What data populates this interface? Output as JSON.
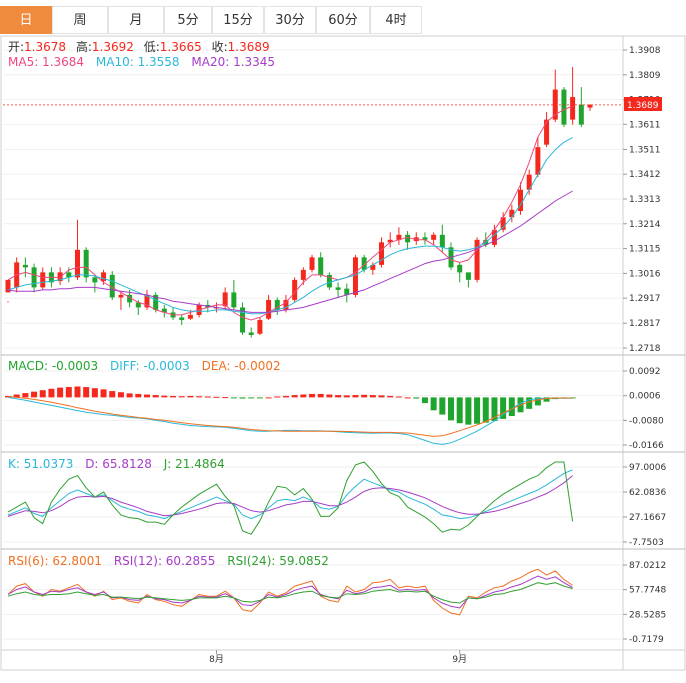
{
  "tabs": [
    {
      "label": "日",
      "active": true
    },
    {
      "label": "周",
      "active": false
    },
    {
      "label": "月",
      "active": false
    },
    {
      "label": "5分",
      "active": false
    },
    {
      "label": "15分",
      "active": false
    },
    {
      "label": "30分",
      "active": false
    },
    {
      "label": "60分",
      "active": false
    },
    {
      "label": "4时",
      "active": false
    }
  ],
  "price_info": {
    "open_label": "开:",
    "open": "1.3678",
    "high_label": "高:",
    "high": "1.3692",
    "low_label": "低:",
    "low": "1.3665",
    "close_label": "收:",
    "close": "1.3689",
    "ma5": "MA5: 1.3684",
    "ma10": "MA10: 1.3558",
    "ma20": "MA20: 1.3345"
  },
  "macd_info": {
    "macd": "MACD: -0.0003",
    "diff": "DIFF: -0.0003",
    "dea": "DEA: -0.0002"
  },
  "kdj_info": {
    "k": "K: 51.0373",
    "d": "D: 65.8128",
    "j": "J: 21.4864"
  },
  "rsi_info": {
    "rsi6": "RSI(6): 62.8001",
    "rsi12": "RSI(12): 60.2855",
    "rsi24": "RSI(24): 59.0852"
  },
  "current_price_label": "1.3689",
  "x_labels": [
    {
      "label": "8月",
      "index": 24
    },
    {
      "label": "9月",
      "index": 52
    }
  ],
  "colors": {
    "up": "#f4281c",
    "down": "#1fa52d",
    "ma5": "#f0487c",
    "ma10": "#2ab8d8",
    "ma20": "#a63cc8",
    "tab_active": "#f08a3c",
    "diff": "#2ab8d8",
    "dea": "#f07020",
    "k": "#2ab8d8",
    "d": "#a63cc8",
    "j": "#30a030",
    "rsi6": "#f07020",
    "rsi12": "#a63cc8",
    "rsi24": "#30a030"
  },
  "chart_data": [
    {
      "type": "candlestick",
      "name": "price",
      "y_ticks": [
        "1.3908",
        "1.3809",
        "1.3710",
        "1.3611",
        "1.3511",
        "1.3412",
        "1.3313",
        "1.3214",
        "1.3115",
        "1.3016",
        "1.2917",
        "1.2817",
        "1.2718"
      ],
      "ylim": [
        1.27,
        1.3935
      ],
      "candles": [
        [
          1.294,
          1.299,
          1.2905,
          1.29
        ],
        [
          1.296,
          1.306,
          1.308,
          1.294
        ],
        [
          1.305,
          1.304,
          1.308,
          1.3
        ],
        [
          1.304,
          1.296,
          1.3055,
          1.294
        ],
        [
          1.296,
          1.302,
          1.304,
          1.295
        ],
        [
          1.302,
          1.298,
          1.304,
          1.296
        ],
        [
          1.2985,
          1.302,
          1.304,
          1.297
        ],
        [
          1.302,
          1.3,
          1.304,
          1.298
        ],
        [
          1.3,
          1.311,
          1.323,
          1.299
        ],
        [
          1.311,
          1.3,
          1.312,
          1.298
        ],
        [
          1.3,
          1.298,
          1.301,
          1.294
        ],
        [
          1.2985,
          1.302,
          1.303,
          1.297
        ],
        [
          1.301,
          1.292,
          1.3025,
          1.291
        ],
        [
          1.292,
          1.293,
          1.2945,
          1.287
        ],
        [
          1.293,
          1.29,
          1.295,
          1.288
        ],
        [
          1.29,
          1.288,
          1.291,
          1.285
        ],
        [
          1.288,
          1.293,
          1.295,
          1.287
        ],
        [
          1.293,
          1.287,
          1.294,
          1.286
        ],
        [
          1.2875,
          1.286,
          1.289,
          1.284
        ],
        [
          1.286,
          1.284,
          1.288,
          1.283
        ],
        [
          1.284,
          1.283,
          1.285,
          1.281
        ],
        [
          1.2835,
          1.285,
          1.287,
          1.283
        ],
        [
          1.285,
          1.289,
          1.29,
          1.284
        ],
        [
          1.289,
          1.288,
          1.291,
          1.286
        ],
        [
          1.288,
          1.288,
          1.29,
          1.286
        ],
        [
          1.2885,
          1.294,
          1.296,
          1.287
        ],
        [
          1.294,
          1.288,
          1.299,
          1.287
        ],
        [
          1.288,
          1.278,
          1.29,
          1.277
        ],
        [
          1.278,
          1.277,
          1.28,
          1.276
        ],
        [
          1.2775,
          1.283,
          1.284,
          1.277
        ],
        [
          1.2835,
          1.291,
          1.293,
          1.283
        ],
        [
          1.291,
          1.287,
          1.292,
          1.285
        ],
        [
          1.287,
          1.291,
          1.293,
          1.286
        ],
        [
          1.291,
          1.299,
          1.3,
          1.29
        ],
        [
          1.299,
          1.303,
          1.304,
          1.297
        ],
        [
          1.303,
          1.308,
          1.309,
          1.302
        ],
        [
          1.308,
          1.301,
          1.31,
          1.3
        ],
        [
          1.301,
          1.296,
          1.302,
          1.295
        ],
        [
          1.296,
          1.295,
          1.298,
          1.292
        ],
        [
          1.2955,
          1.293,
          1.2975,
          1.29
        ],
        [
          1.293,
          1.308,
          1.309,
          1.292
        ],
        [
          1.308,
          1.303,
          1.309,
          1.302
        ],
        [
          1.303,
          1.305,
          1.306,
          1.301
        ],
        [
          1.305,
          1.314,
          1.316,
          1.304
        ],
        [
          1.314,
          1.315,
          1.318,
          1.312
        ],
        [
          1.315,
          1.317,
          1.32,
          1.313
        ],
        [
          1.317,
          1.314,
          1.3185,
          1.311
        ],
        [
          1.3145,
          1.316,
          1.318,
          1.313
        ],
        [
          1.316,
          1.315,
          1.318,
          1.313
        ],
        [
          1.315,
          1.317,
          1.318,
          1.313
        ],
        [
          1.317,
          1.312,
          1.321,
          1.31
        ],
        [
          1.312,
          1.304,
          1.314,
          1.303
        ],
        [
          1.305,
          1.302,
          1.306,
          1.298
        ],
        [
          1.302,
          1.299,
          1.3,
          1.296
        ],
        [
          1.299,
          1.315,
          1.316,
          1.298
        ],
        [
          1.315,
          1.313,
          1.318,
          1.312
        ],
        [
          1.313,
          1.319,
          1.321,
          1.312
        ],
        [
          1.319,
          1.324,
          1.326,
          1.318
        ],
        [
          1.324,
          1.327,
          1.329,
          1.322
        ],
        [
          1.3265,
          1.335,
          1.338,
          1.325
        ],
        [
          1.335,
          1.341,
          1.343,
          1.333
        ],
        [
          1.341,
          1.352,
          1.356,
          1.34
        ],
        [
          1.353,
          1.363,
          1.366,
          1.352
        ],
        [
          1.363,
          1.375,
          1.383,
          1.362
        ],
        [
          1.375,
          1.361,
          1.376,
          1.36
        ],
        [
          1.363,
          1.372,
          1.384,
          1.361
        ],
        [
          1.369,
          1.361,
          1.376,
          1.36
        ],
        [
          1.3678,
          1.3689,
          1.3692,
          1.3665
        ]
      ],
      "ma5": [
        1.299,
        1.301,
        1.302,
        1.301,
        1.3,
        1.3,
        1.3,
        1.303,
        1.304,
        1.304,
        1.301,
        1.298,
        1.296,
        1.294,
        1.292,
        1.29,
        1.289,
        1.287,
        1.286,
        1.285,
        1.285,
        1.286,
        1.287,
        1.288,
        1.289,
        1.289,
        1.286,
        1.284,
        1.283,
        1.284,
        1.286,
        1.288,
        1.29,
        1.294,
        1.298,
        1.301,
        1.301,
        1.3,
        1.299,
        1.3,
        1.302,
        1.305,
        1.308,
        1.311,
        1.314,
        1.315,
        1.316,
        1.315,
        1.315,
        1.313,
        1.31,
        1.307,
        1.306,
        1.307,
        1.311,
        1.315,
        1.319,
        1.324,
        1.33,
        1.337,
        1.346,
        1.356,
        1.362,
        1.365,
        1.367,
        1.3684
      ],
      "ma10": [
        1.295,
        1.296,
        1.297,
        1.2975,
        1.298,
        1.2985,
        1.299,
        1.3,
        1.301,
        1.301,
        1.3005,
        1.2995,
        1.2985,
        1.297,
        1.2955,
        1.294,
        1.2925,
        1.291,
        1.2895,
        1.288,
        1.287,
        1.2865,
        1.2865,
        1.2865,
        1.287,
        1.287,
        1.2865,
        1.286,
        1.2855,
        1.2855,
        1.286,
        1.287,
        1.288,
        1.29,
        1.292,
        1.2945,
        1.2965,
        1.298,
        1.299,
        1.3,
        1.301,
        1.303,
        1.305,
        1.307,
        1.309,
        1.3105,
        1.3115,
        1.312,
        1.3125,
        1.3125,
        1.312,
        1.311,
        1.3105,
        1.311,
        1.312,
        1.314,
        1.317,
        1.32,
        1.324,
        1.329,
        1.335,
        1.341,
        1.347,
        1.351,
        1.354,
        1.3558
      ],
      "ma20": [
        1.295,
        1.2945,
        1.2945,
        1.2945,
        1.295,
        1.295,
        1.2955,
        1.2955,
        1.296,
        1.296,
        1.296,
        1.2955,
        1.295,
        1.2945,
        1.294,
        1.2935,
        1.293,
        1.292,
        1.2915,
        1.2905,
        1.29,
        1.2895,
        1.289,
        1.2885,
        1.288,
        1.2875,
        1.287,
        1.2865,
        1.286,
        1.286,
        1.286,
        1.2865,
        1.287,
        1.2875,
        1.288,
        1.289,
        1.29,
        1.291,
        1.292,
        1.293,
        1.294,
        1.295,
        1.2965,
        1.298,
        1.2995,
        1.301,
        1.3025,
        1.304,
        1.3055,
        1.3065,
        1.307,
        1.308,
        1.309,
        1.31,
        1.3115,
        1.313,
        1.3145,
        1.3165,
        1.3185,
        1.3205,
        1.323,
        1.3255,
        1.328,
        1.3305,
        1.3325,
        1.3345
      ]
    },
    {
      "type": "bar",
      "name": "MACD",
      "y_ticks": [
        "0.0092",
        "0.0006",
        "-0.0080",
        "-0.0166"
      ],
      "ylim": [
        -0.0185,
        0.0105
      ],
      "macd": [
        0.0005,
        0.001,
        0.0015,
        0.002,
        0.0025,
        0.003,
        0.0034,
        0.0036,
        0.0038,
        0.0036,
        0.0032,
        0.0028,
        0.0022,
        0.0018,
        0.0014,
        0.0012,
        0.001,
        0.0008,
        0.0006,
        0.0005,
        0.0004,
        0.0005,
        0.0004,
        0.0003,
        0.0002,
        0.0001,
        -0.0002,
        -0.0004,
        -0.0003,
        -0.0002,
        0.0,
        0.0003,
        0.0005,
        0.0008,
        0.001,
        0.0012,
        0.0012,
        0.001,
        0.0008,
        0.0007,
        0.0008,
        0.0009,
        0.0008,
        0.0007,
        0.0005,
        0.0003,
        0.0,
        -0.0004,
        -0.002,
        -0.0045,
        -0.006,
        -0.008,
        -0.009,
        -0.0095,
        -0.0092,
        -0.0088,
        -0.0082,
        -0.0075,
        -0.0065,
        -0.0052,
        -0.004,
        -0.0028,
        -0.0015,
        -0.0006,
        -0.0004,
        -0.0003
      ],
      "diff": [
        0.0,
        -0.0005,
        -0.001,
        -0.0016,
        -0.0022,
        -0.0028,
        -0.0034,
        -0.004,
        -0.0046,
        -0.0052,
        -0.0056,
        -0.006,
        -0.0062,
        -0.0066,
        -0.007,
        -0.0072,
        -0.0075,
        -0.008,
        -0.0084,
        -0.009,
        -0.0094,
        -0.0098,
        -0.01,
        -0.0102,
        -0.0103,
        -0.0104,
        -0.0108,
        -0.0112,
        -0.0116,
        -0.0118,
        -0.0118,
        -0.0116,
        -0.0115,
        -0.0115,
        -0.0116,
        -0.0116,
        -0.0117,
        -0.0118,
        -0.012,
        -0.0122,
        -0.0123,
        -0.0124,
        -0.0125,
        -0.0124,
        -0.0124,
        -0.0126,
        -0.013,
        -0.014,
        -0.015,
        -0.016,
        -0.0164,
        -0.0158,
        -0.0146,
        -0.0132,
        -0.0118,
        -0.01,
        -0.0082,
        -0.006,
        -0.004,
        -0.002,
        -0.0008,
        -0.0004,
        -0.0003,
        -0.0003,
        -0.0003,
        -0.0003
      ],
      "dea": [
        0.0003,
        0.0,
        -0.0003,
        -0.0007,
        -0.0012,
        -0.0017,
        -0.0023,
        -0.0029,
        -0.0036,
        -0.0042,
        -0.0048,
        -0.0053,
        -0.0058,
        -0.0062,
        -0.0066,
        -0.007,
        -0.0073,
        -0.0077,
        -0.008,
        -0.0084,
        -0.0088,
        -0.0092,
        -0.0095,
        -0.0098,
        -0.01,
        -0.0102,
        -0.0104,
        -0.0108,
        -0.0112,
        -0.0114,
        -0.0116,
        -0.0117,
        -0.0118,
        -0.0118,
        -0.0118,
        -0.0118,
        -0.0118,
        -0.0118,
        -0.0118,
        -0.0119,
        -0.012,
        -0.0121,
        -0.0122,
        -0.0122,
        -0.0122,
        -0.0123,
        -0.0124,
        -0.0128,
        -0.0132,
        -0.0136,
        -0.0134,
        -0.0126,
        -0.0116,
        -0.0106,
        -0.0096,
        -0.0084,
        -0.007,
        -0.0054,
        -0.004,
        -0.0026,
        -0.0016,
        -0.0008,
        -0.0004,
        -0.0002,
        -0.0002,
        -0.0002
      ]
    },
    {
      "type": "line",
      "name": "KDJ",
      "y_ticks": [
        "97.0006",
        "62.0836",
        "27.1667",
        "-7.7503"
      ],
      "ylim": [
        -14,
        104
      ],
      "k": [
        30,
        35,
        40,
        32,
        28,
        40,
        50,
        60,
        65,
        60,
        55,
        58,
        50,
        42,
        38,
        35,
        30,
        28,
        25,
        30,
        35,
        40,
        45,
        50,
        55,
        50,
        45,
        30,
        25,
        30,
        40,
        50,
        52,
        50,
        55,
        50,
        40,
        38,
        42,
        58,
        70,
        80,
        75,
        70,
        65,
        62,
        55,
        50,
        45,
        38,
        30,
        28,
        25,
        26,
        30,
        35,
        40,
        45,
        50,
        55,
        60,
        65,
        72,
        80,
        88,
        93
      ],
      "d": [
        28,
        32,
        36,
        35,
        33,
        36,
        42,
        50,
        55,
        56,
        55,
        56,
        53,
        48,
        44,
        40,
        35,
        32,
        29,
        30,
        32,
        35,
        38,
        42,
        46,
        47,
        46,
        41,
        36,
        34,
        36,
        40,
        44,
        46,
        49,
        49,
        46,
        43,
        43,
        48,
        55,
        63,
        67,
        68,
        67,
        65,
        62,
        58,
        54,
        48,
        42,
        37,
        33,
        31,
        31,
        33,
        35,
        38,
        42,
        46,
        50,
        55,
        60,
        67,
        75,
        85
      ],
      "j": [
        34,
        41,
        48,
        26,
        18,
        48,
        66,
        80,
        85,
        68,
        55,
        62,
        44,
        30,
        26,
        25,
        20,
        20,
        17,
        30,
        41,
        50,
        59,
        66,
        73,
        56,
        43,
        8,
        3,
        22,
        48,
        70,
        68,
        58,
        67,
        52,
        28,
        28,
        40,
        78,
        100,
        114,
        91,
        74,
        61,
        56,
        41,
        34,
        27,
        18,
        6,
        10,
        9,
        16,
        28,
        39,
        50,
        59,
        66,
        73,
        80,
        85,
        96,
        106,
        114,
        21
      ]
    },
    {
      "type": "line",
      "name": "RSI",
      "y_ticks": [
        "87.0212",
        "57.7748",
        "28.5285",
        "-0.7179"
      ],
      "ylim": [
        -7,
        94
      ],
      "rsi6": [
        52,
        62,
        65,
        55,
        50,
        58,
        56,
        60,
        64,
        55,
        50,
        56,
        46,
        48,
        44,
        42,
        52,
        46,
        44,
        40,
        38,
        45,
        52,
        50,
        50,
        56,
        48,
        34,
        32,
        42,
        55,
        50,
        54,
        62,
        65,
        68,
        50,
        45,
        43,
        62,
        55,
        58,
        66,
        67,
        70,
        60,
        62,
        60,
        62,
        45,
        36,
        30,
        28,
        50,
        48,
        55,
        60,
        62,
        68,
        72,
        78,
        82,
        75,
        80,
        70,
        62.8001
      ],
      "rsi12": [
        52,
        58,
        61,
        55,
        52,
        56,
        55,
        58,
        60,
        55,
        52,
        55,
        48,
        49,
        46,
        45,
        50,
        47,
        46,
        43,
        42,
        45,
        50,
        49,
        49,
        53,
        48,
        40,
        39,
        44,
        52,
        49,
        52,
        57,
        60,
        62,
        52,
        49,
        47,
        57,
        53,
        55,
        60,
        61,
        63,
        57,
        58,
        57,
        58,
        48,
        42,
        38,
        36,
        48,
        47,
        51,
        55,
        57,
        61,
        64,
        69,
        74,
        70,
        73,
        66,
        60.2855
      ],
      "rsi24": [
        50,
        53,
        55,
        52,
        51,
        52,
        52,
        53,
        55,
        53,
        51,
        52,
        49,
        49,
        48,
        47,
        49,
        48,
        47,
        46,
        45,
        46,
        48,
        48,
        48,
        50,
        48,
        44,
        43,
        45,
        49,
        48,
        50,
        53,
        55,
        56,
        51,
        49,
        48,
        53,
        52,
        53,
        56,
        57,
        58,
        55,
        56,
        55,
        56,
        50,
        46,
        43,
        42,
        48,
        47,
        49,
        52,
        53,
        56,
        58,
        62,
        66,
        64,
        66,
        62,
        59.0852
      ]
    }
  ]
}
